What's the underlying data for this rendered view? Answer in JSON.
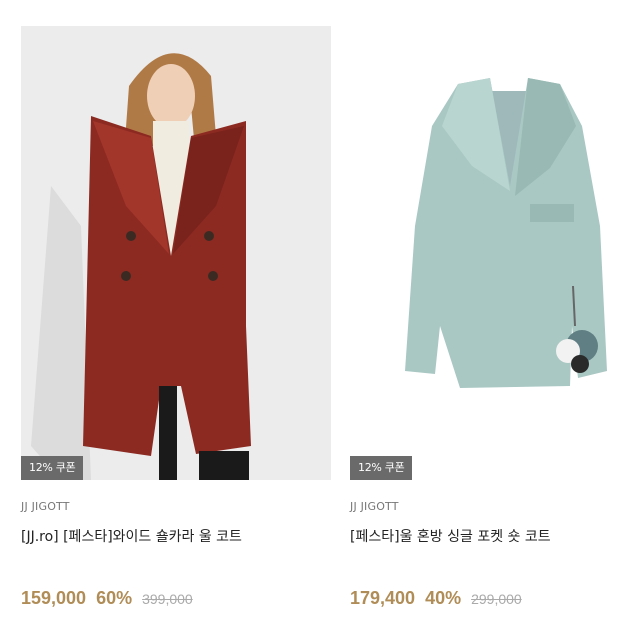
{
  "products": [
    {
      "coupon": "12% 쿠폰",
      "brand": "JJ JIGOTT",
      "name": "[JJ.ro] [페스타]와이드 숄카라 울 코트",
      "price": "159,000",
      "discount": "60%",
      "original_price": "399,000",
      "image": "model-in-red-wool-coat-photo",
      "colors": {
        "coat": "#8c2a22",
        "background": "#ececec"
      }
    },
    {
      "coupon": "12% 쿠폰",
      "brand": "JJ JIGOTT",
      "name": "[페스타]울 혼방 싱글 포켓 숏 코트",
      "price": "179,400",
      "discount": "40%",
      "original_price": "299,000",
      "image": "mint-short-coat-photo",
      "colors": {
        "coat": "#a9c8c3",
        "background": "#ffffff"
      }
    }
  ],
  "accent_color": "#b08d57"
}
